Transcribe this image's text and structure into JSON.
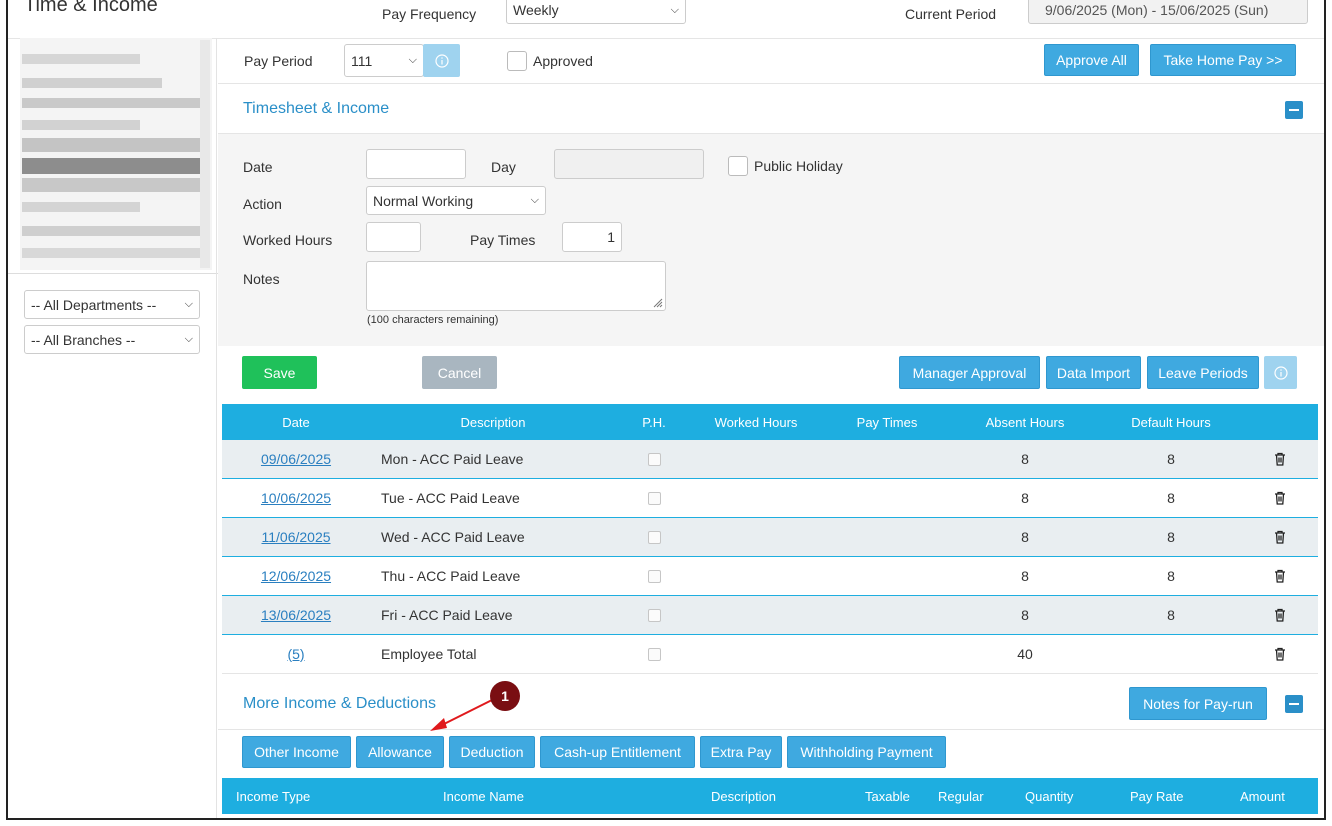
{
  "app": {
    "title": "Time & Income"
  },
  "header": {
    "pay_frequency_label": "Pay Frequency",
    "pay_frequency_value": "Weekly",
    "current_period_label": "Current Period",
    "current_period_value": "9/06/2025 (Mon) - 15/06/2025 (Sun)"
  },
  "sidebar": {
    "departments_select": "-- All Departments --",
    "branches_select": "-- All Branches --"
  },
  "period_bar": {
    "pay_period_label": "Pay Period",
    "pay_period_value": "111",
    "approved_label": "Approved",
    "approve_all_label": "Approve All",
    "take_home_label": "Take Home Pay >>"
  },
  "timesheet": {
    "title": "Timesheet & Income",
    "date_label": "Date",
    "day_label": "Day",
    "public_holiday_label": "Public Holiday",
    "action_label": "Action",
    "action_value": "Normal Working",
    "worked_hours_label": "Worked Hours",
    "pay_times_label": "Pay Times",
    "pay_times_value": "1",
    "notes_label": "Notes",
    "notes_hint": "(100 characters remaining)",
    "save_label": "Save",
    "cancel_label": "Cancel",
    "manager_approval_label": "Manager Approval",
    "data_import_label": "Data Import",
    "leave_periods_label": "Leave Periods"
  },
  "table": {
    "columns": [
      "Date",
      "Description",
      "P.H.",
      "Worked Hours",
      "Pay Times",
      "Absent Hours",
      "Default Hours"
    ],
    "rows": [
      {
        "date": "09/06/2025",
        "description": "Mon - ACC Paid Leave",
        "absent": "8",
        "default": "8"
      },
      {
        "date": "10/06/2025",
        "description": "Tue - ACC Paid Leave",
        "absent": "8",
        "default": "8"
      },
      {
        "date": "11/06/2025",
        "description": "Wed - ACC Paid Leave",
        "absent": "8",
        "default": "8"
      },
      {
        "date": "12/06/2025",
        "description": "Thu - ACC Paid Leave",
        "absent": "8",
        "default": "8"
      },
      {
        "date": "13/06/2025",
        "description": "Fri - ACC Paid Leave",
        "absent": "8",
        "default": "8"
      }
    ],
    "total": {
      "date": "(5)",
      "description": "Employee Total",
      "absent": "40",
      "default": ""
    }
  },
  "more": {
    "title": "More Income & Deductions",
    "notes_btn": "Notes for Pay-run",
    "tabs": [
      "Other Income",
      "Allowance",
      "Deduction",
      "Cash-up Entitlement",
      "Extra Pay",
      "Withholding Payment"
    ],
    "columns": [
      "Income Type",
      "Income Name",
      "Description",
      "Taxable",
      "Regular",
      "Quantity",
      "Pay Rate",
      "Amount"
    ]
  },
  "annotation": {
    "number": "1",
    "color": "#7a0e12",
    "arrow_color": "#e0191c"
  }
}
